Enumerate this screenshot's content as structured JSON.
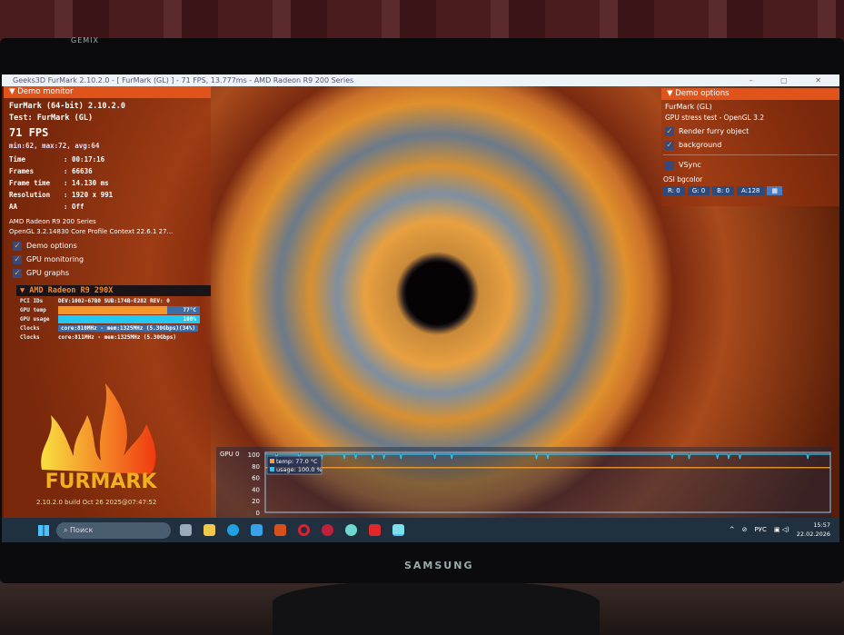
{
  "window_title": "Geeks3D FurMark 2.10.2.0 - [ FurMark (GL) ] - 71 FPS, 13.777ms - AMD Radeon R9 200 Series",
  "window_controls": "– ▢ ✕",
  "monitor_brand": "SAMSUNG",
  "tag_brand": "GEMIX",
  "demo_monitor": {
    "header": "Demo monitor",
    "app": "FurMark (64-bit) 2.10.2.0",
    "test": "Test: FurMark (GL)",
    "fps": "71 FPS",
    "fps_stats": "min:62, max:72, avg:64",
    "stats": [
      {
        "k": "Time",
        "v": ": 00:17:16"
      },
      {
        "k": "Frames",
        "v": ": 66636"
      },
      {
        "k": "Frame time",
        "v": ": 14.130 ms"
      },
      {
        "k": "Resolution",
        "v": ": 1920 x 991"
      },
      {
        "k": "AA",
        "v": ": Off"
      }
    ],
    "gpu_name": "AMD Radeon R9 200 Series",
    "gl_info": "OpenGL 3.2.14830 Core Profile Context 22.6.1 27...",
    "checks": [
      "Demo options",
      "GPU monitoring",
      "GPU graphs"
    ]
  },
  "gpu_block": {
    "header": "AMD Radeon R9 290X",
    "pci_label": "PCI IDs",
    "pci_value": "DEV:1002-67B0 SUB:174B-E282 REV: 0",
    "temp_label": "GPU temp",
    "temp_value": "77°C",
    "temp_fraction": 0.77,
    "usage_label": "GPU usage",
    "usage_value": "100%",
    "usage_fraction": 1.0,
    "clocks1_label": "Clocks",
    "clocks1_value": "core:810MHz - mem:1325MHz (5.30Gbps)(34%)",
    "clocks2_label": "Clocks",
    "clocks2_value": "core:811MHz - mem:1325MHz (5.30Gbps)"
  },
  "logo": {
    "text": "FURMARK",
    "build": "2.10.2.0 build Oct 26 2025@07:47:52"
  },
  "demo_options": {
    "header": "Demo options",
    "title": "FurMark (GL)",
    "subtitle": "GPU stress test - OpenGL 3.2",
    "checks": [
      {
        "label": "Render furry object",
        "checked": true
      },
      {
        "label": "background",
        "checked": true
      }
    ],
    "vsync": {
      "label": "VSync",
      "checked": false
    },
    "osi_label": "OSI bgcolor",
    "osi": [
      "R: 0",
      "G: 0",
      "B: 0",
      "A:128"
    ]
  },
  "gpu_graph": {
    "title": "GPU 0",
    "yticks": [
      "100",
      "80",
      "60",
      "40",
      "20",
      "0"
    ],
    "ylim": [
      0,
      100
    ],
    "legend": [
      "temp: 77.0 °C",
      "usage: 100.0 %"
    ],
    "temp_value": 77,
    "usage_value": 100,
    "usage_dips": [
      0.02,
      0.06,
      0.1,
      0.14,
      0.16,
      0.19,
      0.21,
      0.24,
      0.3,
      0.33,
      0.48,
      0.5,
      0.72,
      0.75,
      0.8,
      0.82,
      0.84,
      0.96
    ],
    "colors": {
      "temp": "#f5a033",
      "usage": "#29c4f0"
    }
  },
  "taskbar": {
    "search": "Поиск",
    "lang": "РУС",
    "time": "15:57",
    "date": "22.02.2026"
  }
}
